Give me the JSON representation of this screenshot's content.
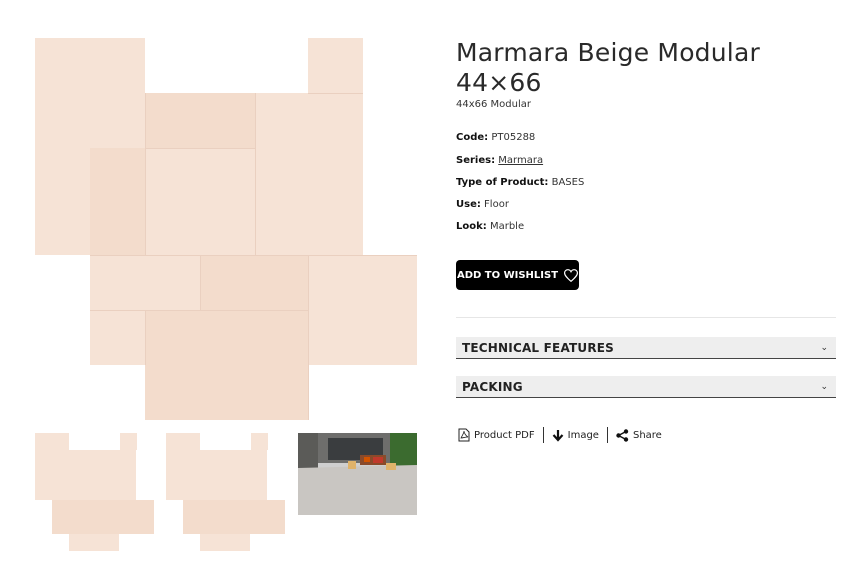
{
  "product": {
    "title": "Marmara Beige Modular 44×66",
    "subtitle": "44x66 Modular"
  },
  "specs": {
    "code_label": "Code:",
    "code_value": "PT05288",
    "series_label": "Series:",
    "series_value": "Marmara",
    "type_label": "Type of Product:",
    "type_value": "BASES",
    "use_label": "Use:",
    "use_value": "Floor",
    "look_label": "Look:",
    "look_value": "Marble"
  },
  "wishlist": {
    "label": "ADD TO WISHLIST",
    "icon": "heart-icon"
  },
  "accordions": {
    "technical": "TECHNICAL FEATURES",
    "packing": "PACKING"
  },
  "actions": {
    "pdf": "Product PDF",
    "image": "Image",
    "share": "Share"
  },
  "colors": {
    "tile": "#f6e3d6",
    "button_bg": "#000000",
    "accordion_bg": "#eeeeee"
  }
}
